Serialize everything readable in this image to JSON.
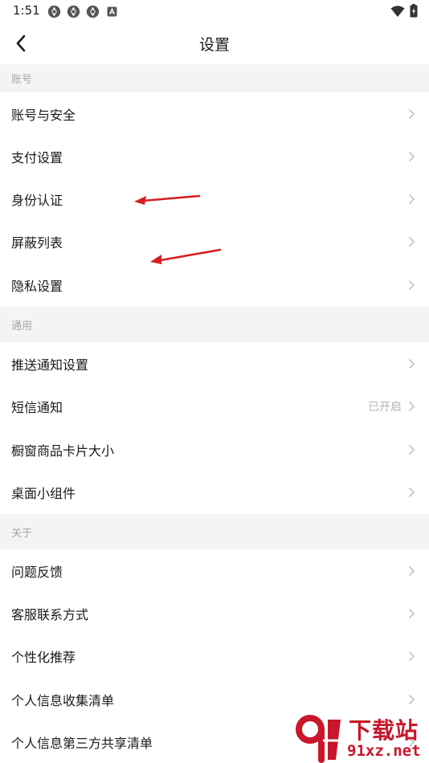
{
  "status_bar": {
    "time": "1:51",
    "left_icons": [
      "aperture-icon",
      "aperture-icon",
      "aperture-icon",
      "a-box-icon"
    ],
    "right_icons": [
      "wifi-icon",
      "battery-charging-icon"
    ]
  },
  "header": {
    "title": "设置",
    "back_icon": "chevron-left-icon"
  },
  "sections": [
    {
      "title": "账号",
      "items": [
        {
          "label": "账号与安全"
        },
        {
          "label": "支付设置"
        },
        {
          "label": "身份认证"
        },
        {
          "label": "屏蔽列表"
        },
        {
          "label": "隐私设置"
        }
      ]
    },
    {
      "title": "通用",
      "items": [
        {
          "label": "推送通知设置"
        },
        {
          "label": "短信通知",
          "value": "已开启"
        },
        {
          "label": "橱窗商品卡片大小"
        },
        {
          "label": "桌面小组件"
        }
      ]
    },
    {
      "title": "关于",
      "items": [
        {
          "label": "问题反馈"
        },
        {
          "label": "客服联系方式"
        },
        {
          "label": "个性化推荐"
        },
        {
          "label": "个人信息收集清单"
        },
        {
          "label": "个人信息第三方共享清单"
        }
      ]
    }
  ],
  "colors": {
    "accent_arrow": "#d81e1e",
    "section_bg": "#f4f4f4",
    "section_text": "#a7a7a7",
    "chevron": "#c4c4c4",
    "watermark": "#c8162a"
  },
  "watermark": {
    "brand": "下载站",
    "domain": "91xz.net"
  }
}
